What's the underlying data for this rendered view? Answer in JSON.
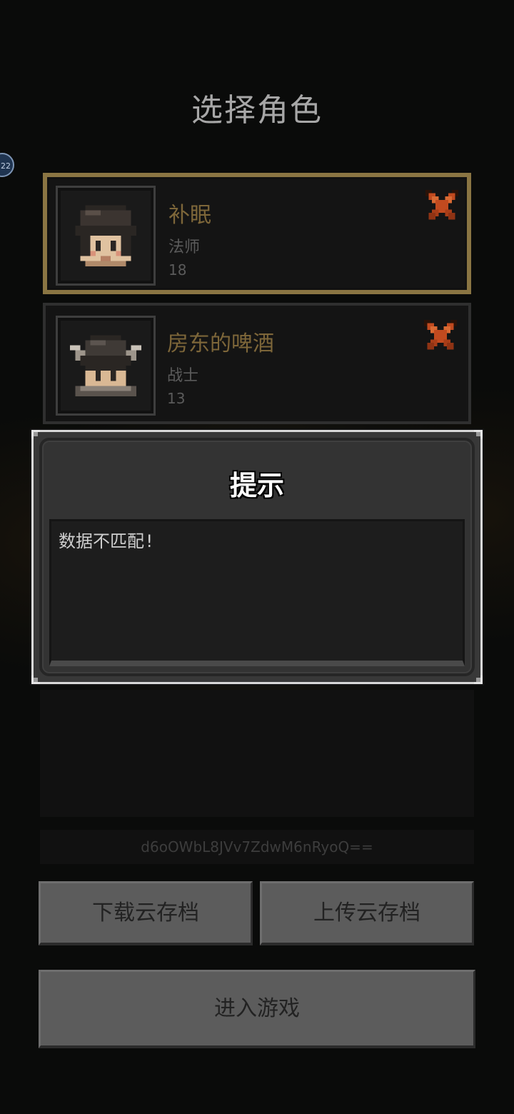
{
  "page": {
    "title": "选择角色"
  },
  "side_badge": {
    "text": "22"
  },
  "characters": [
    {
      "name": "补眠",
      "class": "法师",
      "level": "18",
      "selected": true,
      "avatar": "helmet-mage-icon"
    },
    {
      "name": "房东的啤酒",
      "class": "战士",
      "level": "13",
      "selected": false,
      "avatar": "horned-helmet-warrior-icon"
    }
  ],
  "save_token": "d6oOWbL8JVv7ZdwM6nRyoQ==",
  "buttons": {
    "download_cloud_save": "下载云存档",
    "upload_cloud_save": "上传云存档",
    "enter_game": "进入游戏"
  },
  "dialog": {
    "title": "提示",
    "message": "数据不匹配!"
  },
  "colors": {
    "name_gold": "#7d6639",
    "selected_border": "#8a7543",
    "delete_x": "#c14a1f"
  }
}
